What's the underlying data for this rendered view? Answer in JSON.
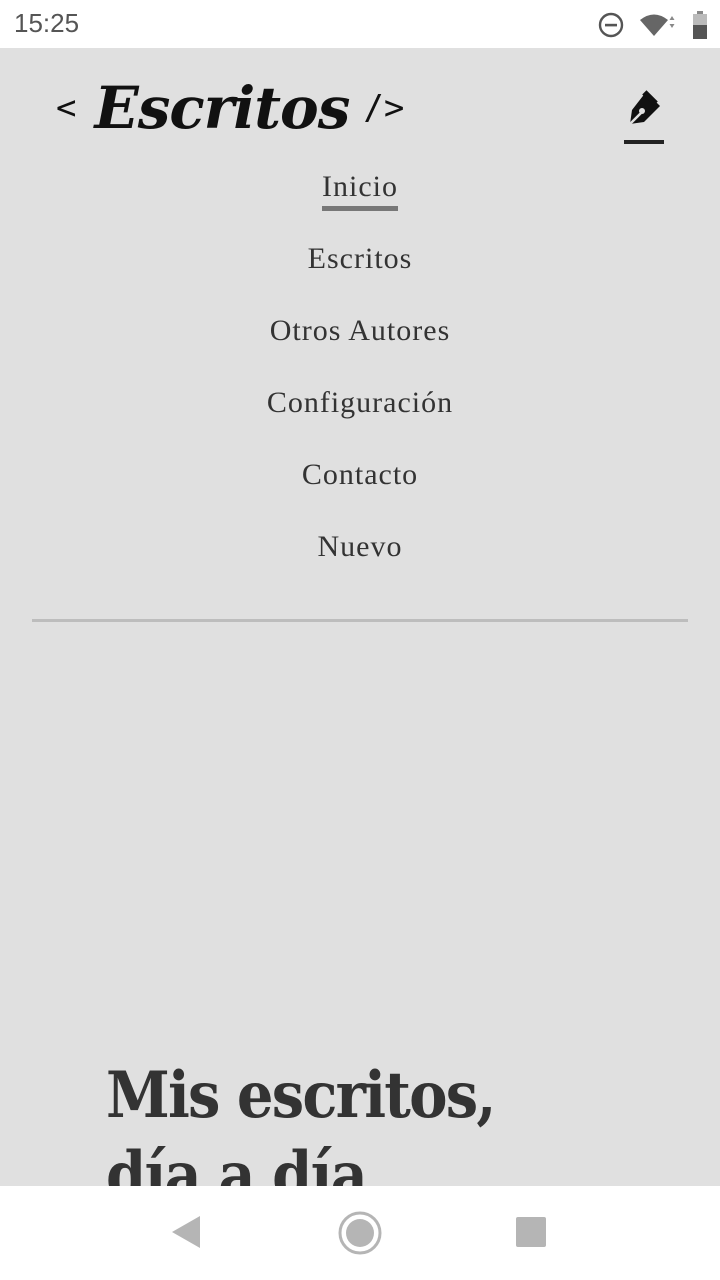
{
  "status_bar": {
    "time": "15:25",
    "icons": [
      "do-not-disturb-icon",
      "wifi-icon",
      "battery-icon"
    ]
  },
  "header": {
    "brand_open": "<",
    "brand_name": "Escritos",
    "brand_close": "/>",
    "action_icon": "pen-icon"
  },
  "nav": {
    "items": [
      {
        "label": "Inicio",
        "active": true
      },
      {
        "label": "Escritos"
      },
      {
        "label": "Otros Autores"
      },
      {
        "label": "Configuración"
      },
      {
        "label": "Contacto"
      },
      {
        "label": "Nuevo"
      }
    ]
  },
  "hero": {
    "line1": "Mis escritos,",
    "line2": "día a día"
  },
  "system_nav": [
    "back-icon",
    "home-icon",
    "recents-icon"
  ],
  "colors": {
    "page_bg": "#e0e0e0",
    "text": "#333333",
    "active_underline": "#777777",
    "divider": "#bdbdbd"
  }
}
